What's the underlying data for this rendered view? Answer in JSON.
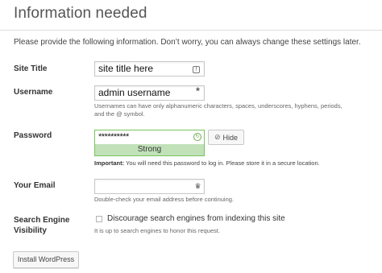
{
  "heading": "Information needed",
  "intro": "Please provide the following information. Don’t worry, you can always change these settings later.",
  "site_title": {
    "label": "Site Title",
    "value": "site title here",
    "icon": "autofill-key-icon"
  },
  "username": {
    "label": "Username",
    "value": "admin username",
    "icon": "autofill-asterisk-icon",
    "description": "Usernames can have only alphanumeric characters, spaces, underscores, hyphens, periods, and the @ symbol."
  },
  "password": {
    "label": "Password",
    "value": "**********",
    "strength": "Strong",
    "hide_label": "Hide",
    "important_prefix": "Important:",
    "important_text": " You will need this password to log in. Please store it in a secure location.",
    "strength_color": "#c1e1b9",
    "border_color": "#78c45d"
  },
  "email": {
    "label": "Your Email",
    "value": "",
    "description": "Double-check your email address before continuing."
  },
  "search_engine": {
    "label_line1": "Search Engine",
    "label_line2": "Visibility",
    "checkbox_label": "Discourage search engines from indexing this site",
    "checked": false,
    "description": "It is up to search engines to honor this request."
  },
  "install_button": "Install WordPress"
}
